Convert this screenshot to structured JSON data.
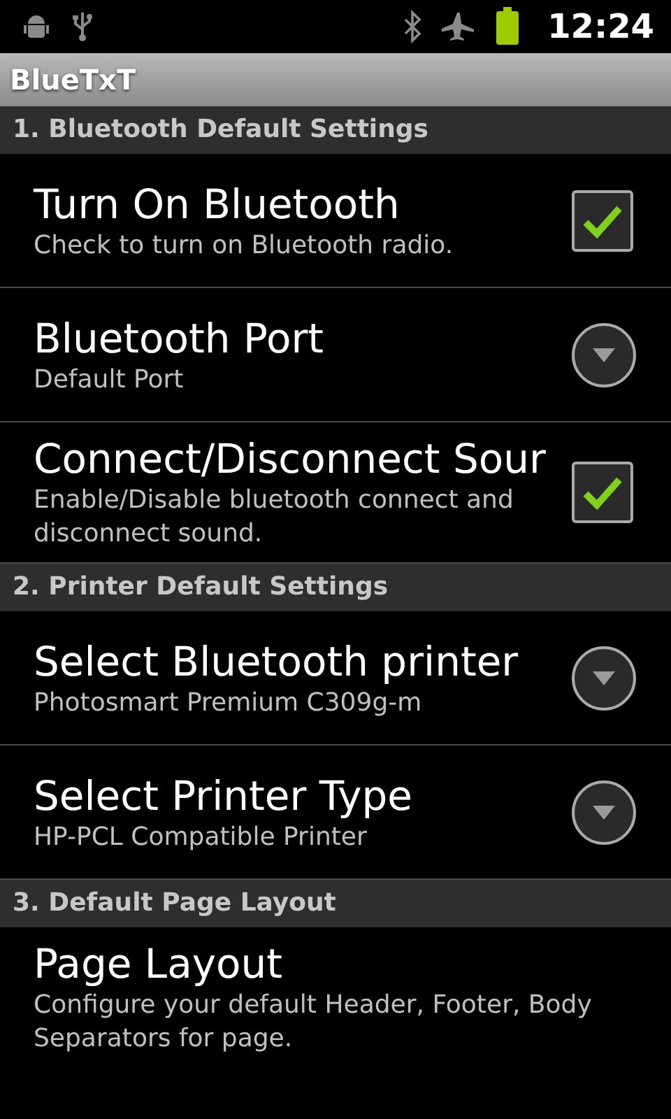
{
  "status_bar": {
    "time": "12:24"
  },
  "title_bar": {
    "title": "BlueTxT"
  },
  "sections": [
    {
      "title": "1. Bluetooth Default Settings",
      "items": [
        {
          "kind": "checkbox",
          "title": "Turn On Bluetooth",
          "summary": "Check to turn on Bluetooth radio.",
          "checked": true
        },
        {
          "kind": "dropdown",
          "title": "Bluetooth Port",
          "summary": "Default Port"
        },
        {
          "kind": "checkbox",
          "title": "Connect/Disconnect Sour",
          "summary": "Enable/Disable bluetooth connect and disconnect sound.",
          "checked": true
        }
      ]
    },
    {
      "title": "2. Printer Default Settings",
      "items": [
        {
          "kind": "dropdown",
          "title": "Select Bluetooth printer",
          "summary": "Photosmart Premium C309g-m"
        },
        {
          "kind": "dropdown",
          "title": "Select Printer Type",
          "summary": "HP-PCL Compatible Printer"
        }
      ]
    },
    {
      "title": "3. Default Page Layout",
      "items": [
        {
          "kind": "plain",
          "title": "Page Layout",
          "summary": "Configure your default Header, Footer, Body Separators for page."
        }
      ]
    }
  ]
}
